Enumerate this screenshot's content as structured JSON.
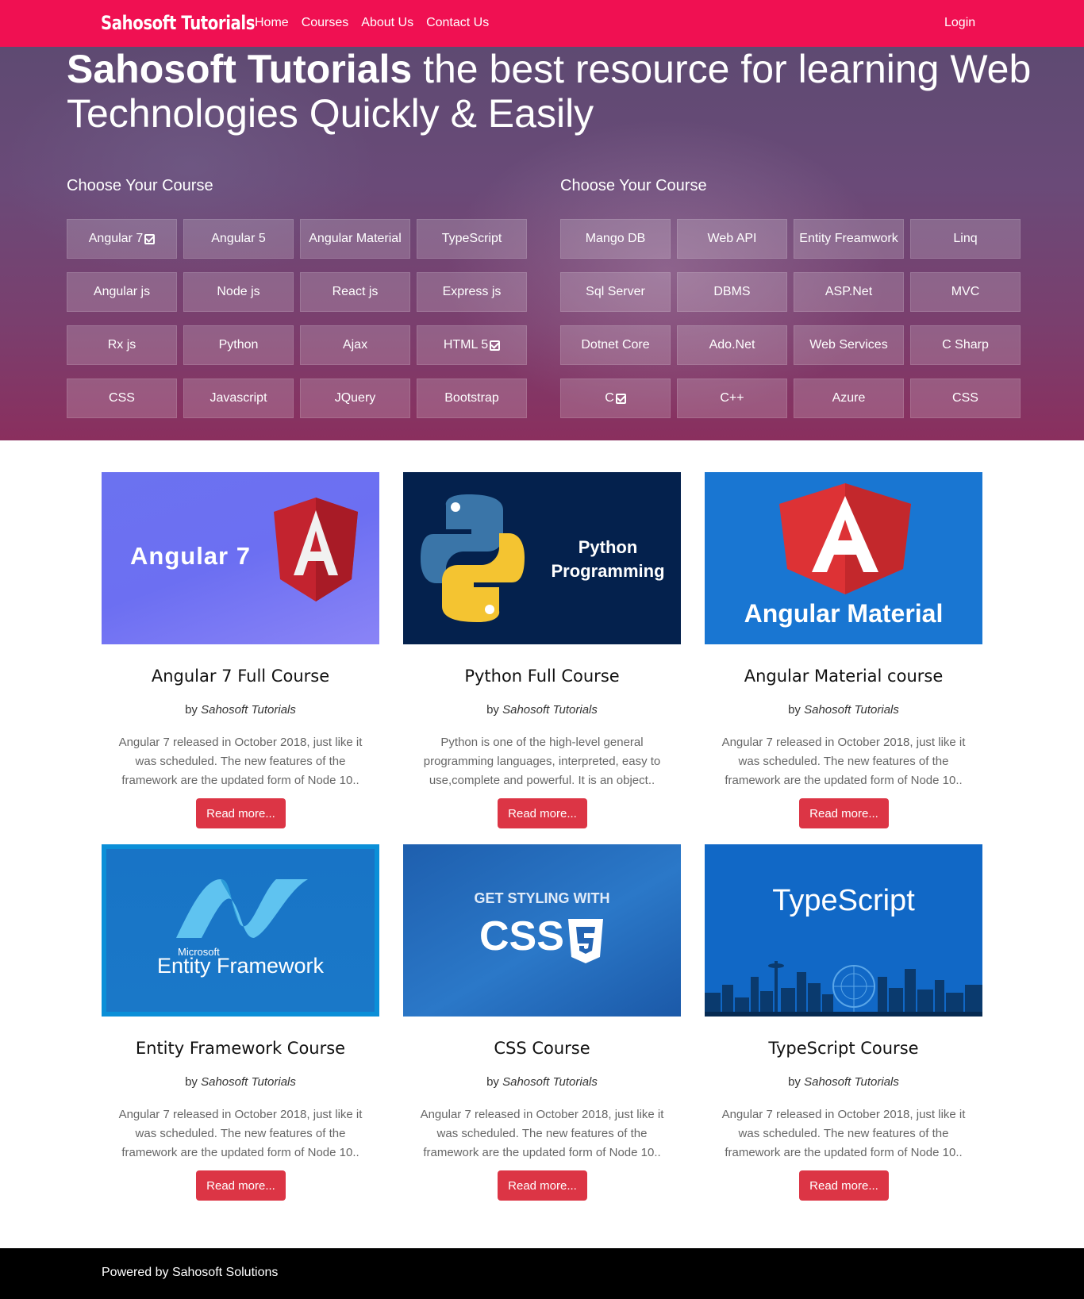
{
  "nav": {
    "brand": "Sahosoft Tutorials",
    "links": [
      "Home",
      "Courses",
      "About Us",
      "Contact Us"
    ],
    "login": "Login"
  },
  "hero": {
    "title_bold": "Sahosoft Tutorials",
    "title_rest": " the best resource for learning Web Technologies Quickly & Easily",
    "left_heading": "Choose Your Course",
    "right_heading": "Choose Your Course",
    "left_courses": [
      {
        "label": "Angular 7",
        "checked": true
      },
      {
        "label": "Angular 5",
        "checked": false
      },
      {
        "label": "Angular Material",
        "checked": false
      },
      {
        "label": "TypeScript",
        "checked": false
      },
      {
        "label": "Angular js",
        "checked": false
      },
      {
        "label": "Node js",
        "checked": false
      },
      {
        "label": "React js",
        "checked": false
      },
      {
        "label": "Express js",
        "checked": false
      },
      {
        "label": "Rx js",
        "checked": false
      },
      {
        "label": "Python",
        "checked": false
      },
      {
        "label": "Ajax",
        "checked": false
      },
      {
        "label": "HTML 5",
        "checked": true
      },
      {
        "label": "CSS",
        "checked": false
      },
      {
        "label": "Javascript",
        "checked": false
      },
      {
        "label": "JQuery",
        "checked": false
      },
      {
        "label": "Bootstrap",
        "checked": false
      }
    ],
    "right_courses": [
      {
        "label": "Mango DB",
        "checked": false
      },
      {
        "label": "Web API",
        "checked": false
      },
      {
        "label": "Entity Freamwork",
        "checked": false
      },
      {
        "label": "Linq",
        "checked": false
      },
      {
        "label": "Sql Server",
        "checked": false
      },
      {
        "label": "DBMS",
        "checked": false
      },
      {
        "label": "ASP.Net",
        "checked": false
      },
      {
        "label": "MVC",
        "checked": false
      },
      {
        "label": "Dotnet Core",
        "checked": false
      },
      {
        "label": "Ado.Net",
        "checked": false
      },
      {
        "label": "Web Services",
        "checked": false
      },
      {
        "label": "C Sharp",
        "checked": false
      },
      {
        "label": "C",
        "checked": true
      },
      {
        "label": "C++",
        "checked": false
      },
      {
        "label": "Azure",
        "checked": false
      },
      {
        "label": "CSS",
        "checked": false
      }
    ]
  },
  "cards": [
    {
      "thumb_text": "Angular 7",
      "title": "Angular 7 Full Course",
      "by": "by ",
      "author": "Sahosoft Tutorials",
      "description": "Angular 7 released in October 2018, just like it was scheduled. The new features of the framework are the updated form of Node 10..",
      "button": "Read more..."
    },
    {
      "thumb_text": "Python Programming",
      "title": "Python Full Course",
      "by": "by ",
      "author": "Sahosoft Tutorials",
      "description": "Python is one of the high-level general programming languages, interpreted, easy to use,complete and powerful. It is an object..",
      "button": "Read more..."
    },
    {
      "thumb_text": "Angular Material",
      "title": "Angular Material course",
      "by": "by ",
      "author": "Sahosoft Tutorials",
      "description": "Angular 7 released in October 2018, just like it was scheduled. The new features of the framework are the updated form of Node 10..",
      "button": "Read more..."
    },
    {
      "thumb_text": "Entity Framework",
      "thumb_sub": "Microsoft",
      "title": "Entity Framework Course",
      "by": "by ",
      "author": "Sahosoft Tutorials",
      "description": "Angular 7 released in October 2018, just like it was scheduled. The new features of the framework are the updated form of Node 10..",
      "button": "Read more..."
    },
    {
      "thumb_text": "CSS",
      "thumb_sub": "GET STYLING WITH",
      "title": "CSS Course",
      "by": "by ",
      "author": "Sahosoft Tutorials",
      "description": "Angular 7 released in October 2018, just like it was scheduled. The new features of the framework are the updated form of Node 10..",
      "button": "Read more..."
    },
    {
      "thumb_text": "TypeScript",
      "title": "TypeScript Course",
      "by": "by ",
      "author": "Sahosoft Tutorials",
      "description": "Angular 7 released in October 2018, just like it was scheduled. The new features of the framework are the updated form of Node 10..",
      "button": "Read more..."
    }
  ],
  "footer": {
    "text": "Powered by Sahosoft Solutions"
  },
  "colors": {
    "navbar": "#f01052",
    "button": "#dc3545",
    "footer": "#000000"
  }
}
